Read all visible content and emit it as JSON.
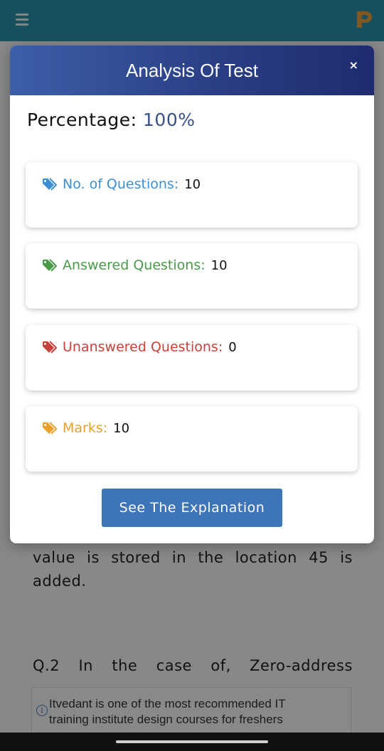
{
  "background": {
    "paragraph_1": "value is stored in the location 45 is added.",
    "question_2_words": [
      "Q.2",
      "In",
      "the",
      "case",
      "of,",
      "Zero-address"
    ],
    "ad": {
      "line_1": "Itvedant is one of the most recommended IT",
      "line_2": "training institute design courses for freshers"
    }
  },
  "modal": {
    "title": "Analysis Of Test",
    "close_label": "×",
    "percentage_label": "Percentage:",
    "percentage_value": "100%",
    "stats": [
      {
        "label": "No. of Questions:",
        "value": "10",
        "color": "#3d8fd4",
        "icon": "tag-icon"
      },
      {
        "label": "Answered Questions:",
        "value": "10",
        "color": "#4a9a4a",
        "icon": "tag-icon"
      },
      {
        "label": "Unanswered Questions:",
        "value": "0",
        "color": "#c8413a",
        "icon": "tag-icon"
      },
      {
        "label": "Marks:",
        "value": "10",
        "color": "#e8a22b",
        "icon": "tag-icon"
      }
    ],
    "explain_button": "See The Explanation"
  },
  "colors": {
    "app_bar": "#2f93b0",
    "modal_header_start": "#3c5fa8",
    "modal_header_end": "#1f2b6e",
    "button": "#3e74b8"
  }
}
